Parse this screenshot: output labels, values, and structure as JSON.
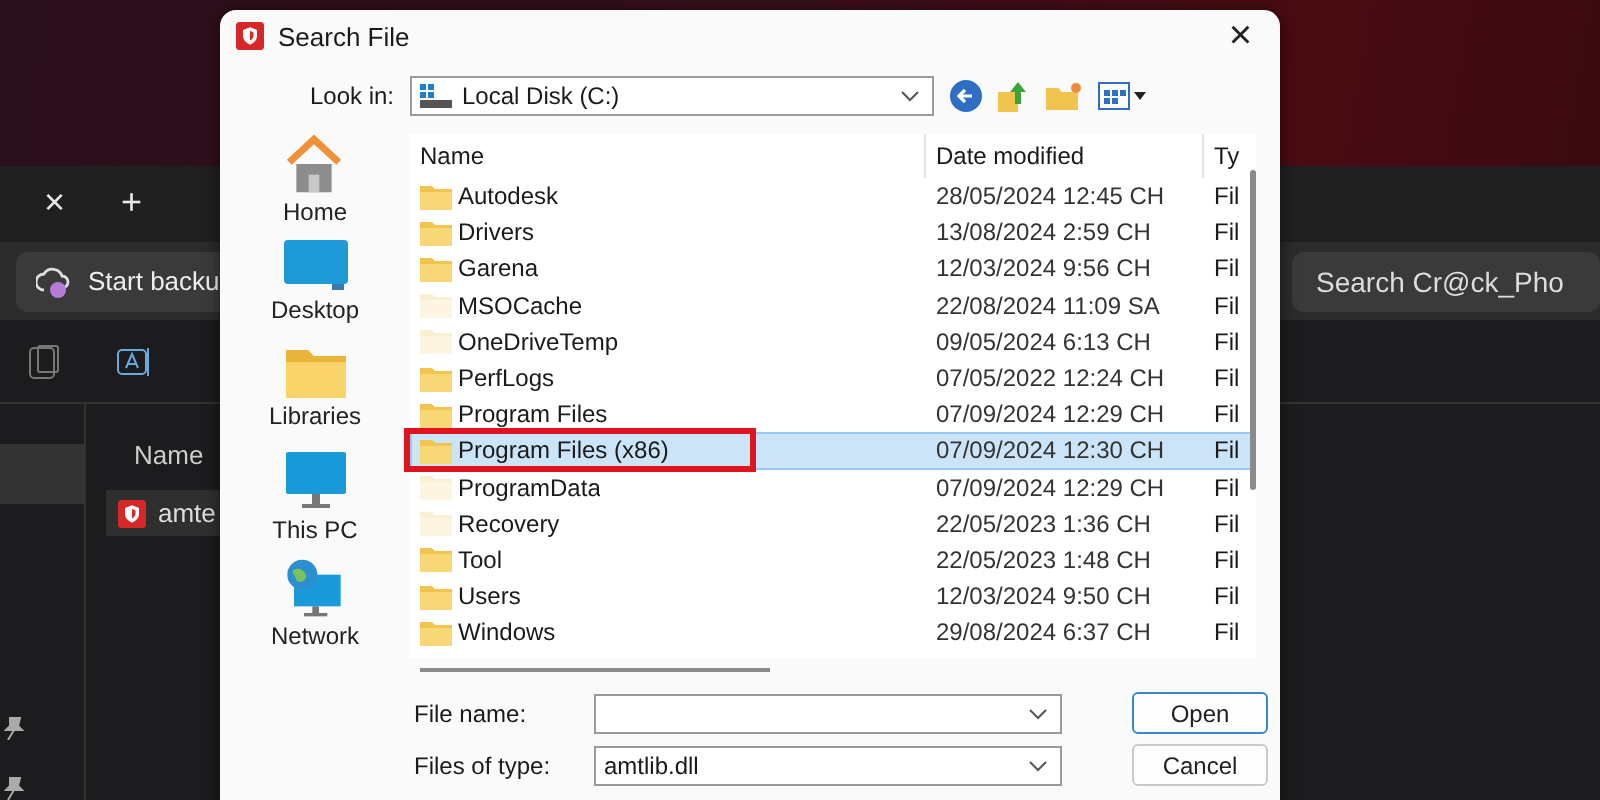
{
  "background_app": {
    "tab_close": "×",
    "tab_new": "+",
    "backup_button": "Start backu",
    "search": {
      "placeholder": "Search Cr@ck_Pho"
    },
    "column_header": "Name",
    "file_name": "amte"
  },
  "dialog": {
    "title": "Search File",
    "close": "×",
    "look_in_label": "Look in:",
    "look_in_value": "Local Disk (C:)",
    "places": [
      {
        "label": "Home",
        "kind": "home"
      },
      {
        "label": "Desktop",
        "kind": "desktop"
      },
      {
        "label": "Libraries",
        "kind": "libraries"
      },
      {
        "label": "This PC",
        "kind": "pc"
      },
      {
        "label": "Network",
        "kind": "network"
      }
    ],
    "columns": [
      "Name",
      "Date modified",
      "Ty"
    ],
    "rows": [
      {
        "name": "Autodesk",
        "date": "28/05/2024 12:45 CH",
        "type": "Fil",
        "hidden": false,
        "selected": false
      },
      {
        "name": "Drivers",
        "date": "13/08/2024 2:59 CH",
        "type": "Fil",
        "hidden": false,
        "selected": false
      },
      {
        "name": "Garena",
        "date": "12/03/2024 9:56 CH",
        "type": "Fil",
        "hidden": false,
        "selected": false
      },
      {
        "name": "MSOCache",
        "date": "22/08/2024 11:09 SA",
        "type": "Fil",
        "hidden": true,
        "selected": false
      },
      {
        "name": "OneDriveTemp",
        "date": "09/05/2024 6:13 CH",
        "type": "Fil",
        "hidden": true,
        "selected": false
      },
      {
        "name": "PerfLogs",
        "date": "07/05/2022 12:24 CH",
        "type": "Fil",
        "hidden": false,
        "selected": false
      },
      {
        "name": "Program Files",
        "date": "07/09/2024 12:29 CH",
        "type": "Fil",
        "hidden": false,
        "selected": false
      },
      {
        "name": "Program Files (x86)",
        "date": "07/09/2024 12:30 CH",
        "type": "Fil",
        "hidden": false,
        "selected": true
      },
      {
        "name": "ProgramData",
        "date": "07/09/2024 12:29 CH",
        "type": "Fil",
        "hidden": true,
        "selected": false
      },
      {
        "name": "Recovery",
        "date": "22/05/2023 1:36 CH",
        "type": "Fil",
        "hidden": true,
        "selected": false
      },
      {
        "name": "Tool",
        "date": "22/05/2023 1:48 CH",
        "type": "Fil",
        "hidden": false,
        "selected": false
      },
      {
        "name": "Users",
        "date": "12/03/2024 9:50 CH",
        "type": "Fil",
        "hidden": false,
        "selected": false
      },
      {
        "name": "Windows",
        "date": "29/08/2024 6:37 CH",
        "type": "Fil",
        "hidden": false,
        "selected": false
      }
    ],
    "file_name_label": "File name:",
    "file_type_label": "Files of type:",
    "file_type_value": "amtlib.dll",
    "buttons": [
      "Open",
      "Cancel"
    ]
  }
}
